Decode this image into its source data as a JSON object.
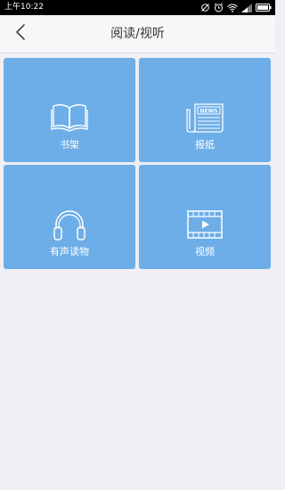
{
  "status_bar": {
    "time": "上午10:22",
    "icons": [
      "sync-icon",
      "alarm-icon",
      "wifi-icon",
      "signal-icon",
      "battery-icon"
    ]
  },
  "header": {
    "title": "阅读/视听",
    "back_icon": "chevron-left-icon"
  },
  "tiles": [
    {
      "label": "书架",
      "icon": "open-book-icon"
    },
    {
      "label": "报纸",
      "icon": "newspaper-icon",
      "icon_text": "NEWS"
    },
    {
      "label": "有声读物",
      "icon": "headphones-icon"
    },
    {
      "label": "视频",
      "icon": "video-film-icon"
    }
  ],
  "colors": {
    "tile_background": "#6daee8",
    "page_background": "#f0eff5",
    "status_bar": "#000000"
  }
}
